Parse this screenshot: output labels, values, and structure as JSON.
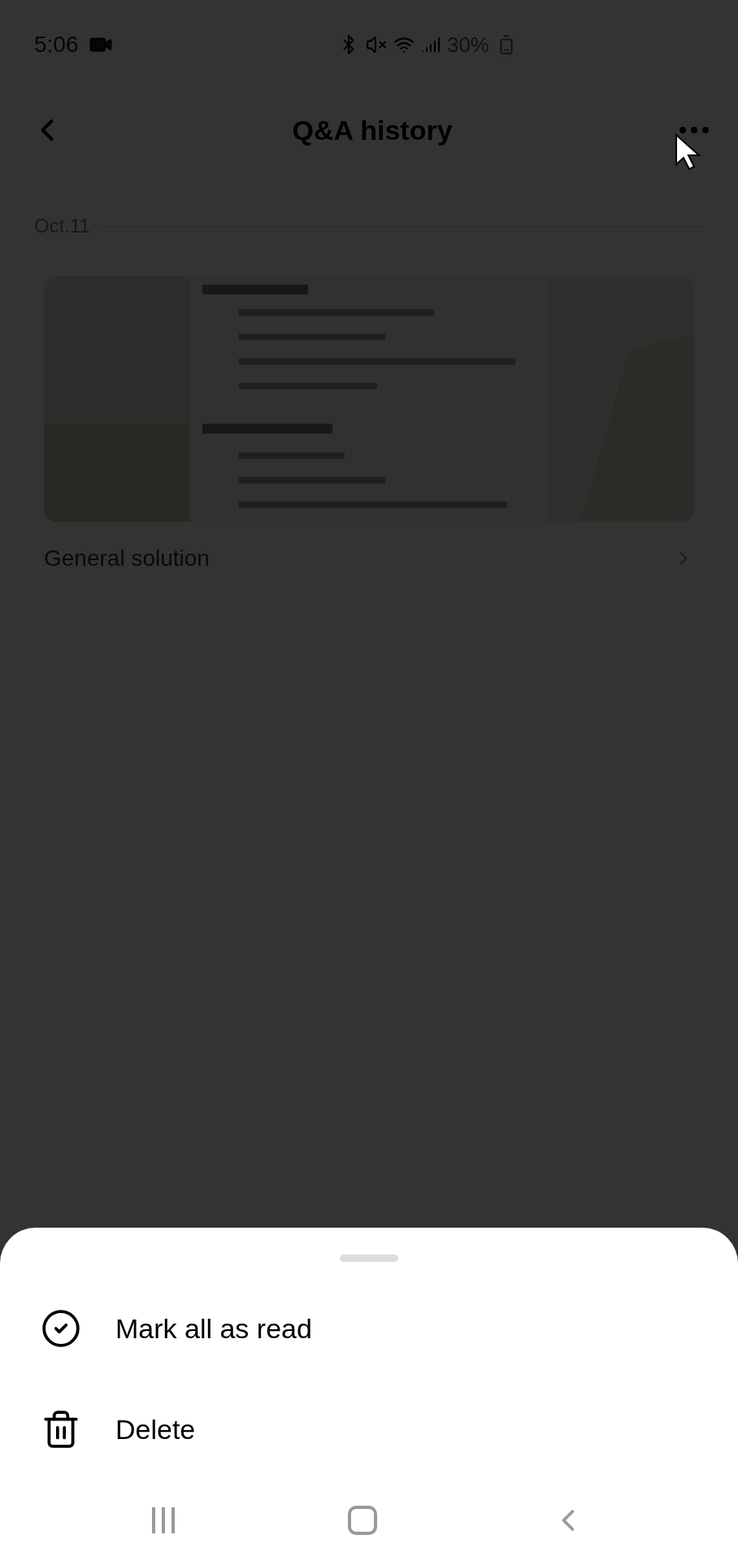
{
  "status_bar": {
    "time": "5:06",
    "battery": "30%"
  },
  "header": {
    "title": "Q&A history"
  },
  "date_divider": {
    "label": "Oct.11"
  },
  "entries": [
    {
      "kind": "picture",
      "title": "General solution"
    }
  ],
  "menu": {
    "items": [
      {
        "kind": "check",
        "label": "Mark all as read"
      },
      {
        "kind": "trash",
        "label": "Delete"
      }
    ]
  }
}
